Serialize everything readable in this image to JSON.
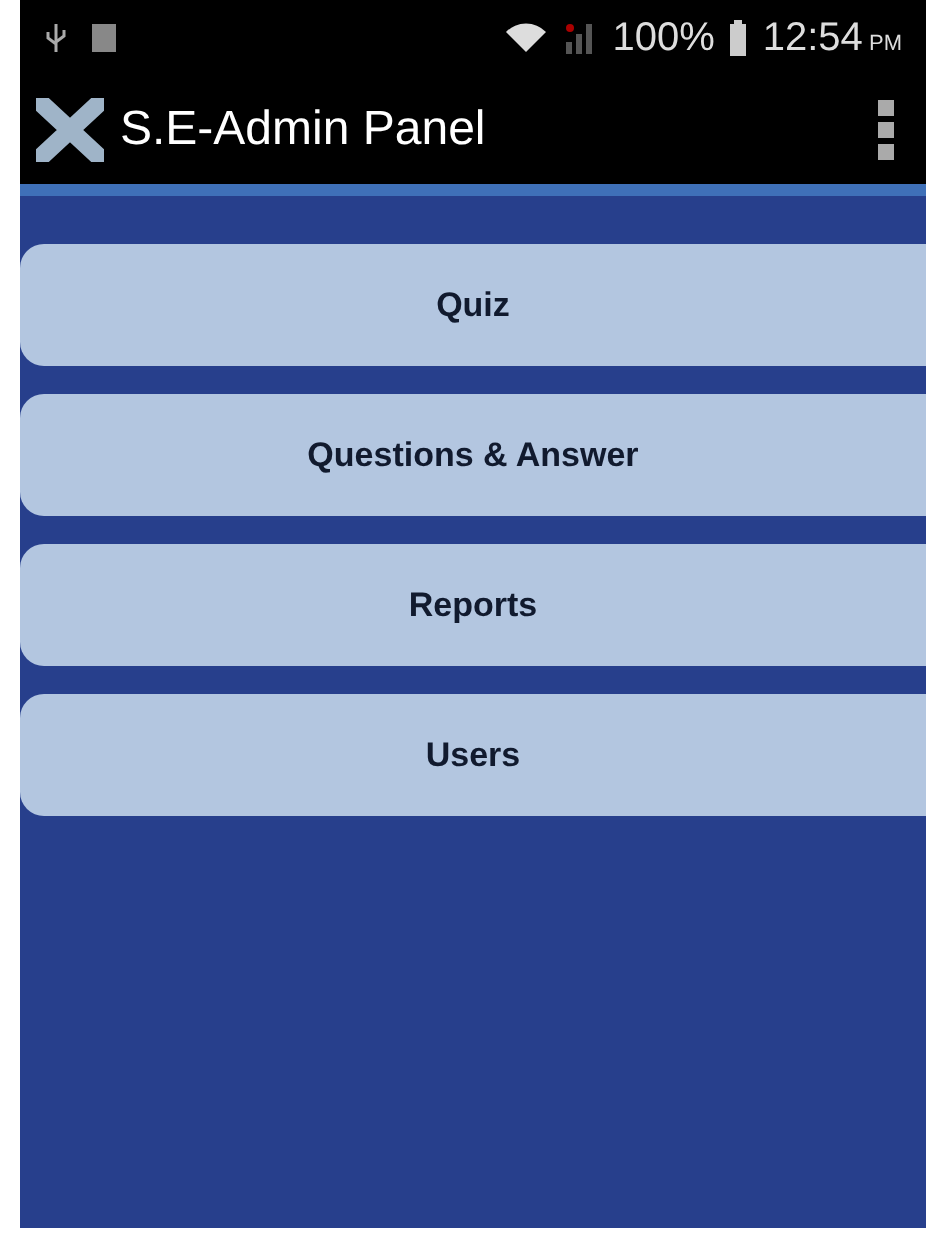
{
  "status_bar": {
    "battery": "100%",
    "time": "12:54",
    "time_suffix": "PM"
  },
  "app_bar": {
    "title": "S.E-Admin Panel"
  },
  "menu_buttons": [
    {
      "label": "Quiz"
    },
    {
      "label": "Questions & Answer"
    },
    {
      "label": "Reports"
    },
    {
      "label": "Users"
    }
  ]
}
